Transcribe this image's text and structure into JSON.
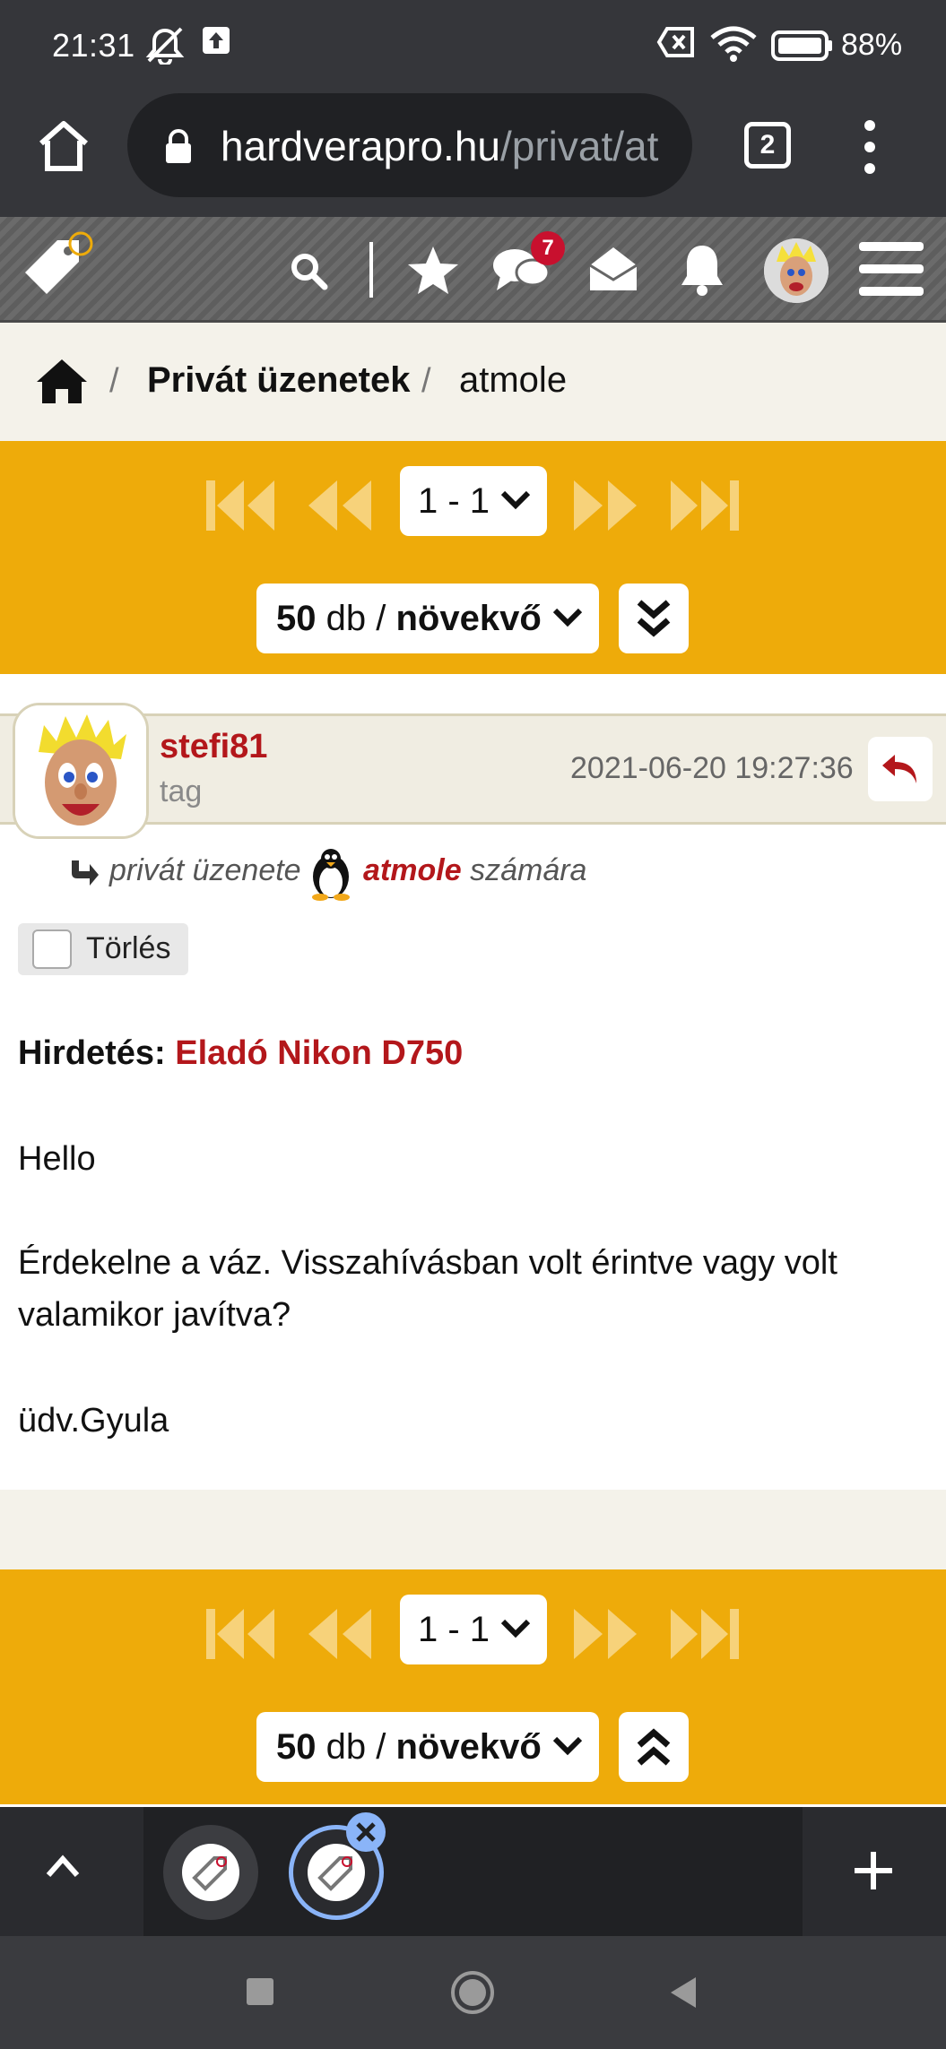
{
  "status_bar": {
    "time": "21:31",
    "battery": "88%",
    "icons": [
      "mute-icon",
      "upload-icon",
      "no-sim-icon",
      "wifi-icon",
      "battery-icon"
    ]
  },
  "browser": {
    "url_domain": "hardverapro.hu",
    "url_path": "/privat/at",
    "tab_count": "2"
  },
  "site_header": {
    "notification_count": "7",
    "icons": [
      "logo-tag-icon",
      "search-icon",
      "star-icon",
      "chat-icon",
      "mail-icon",
      "bell-icon",
      "avatar",
      "menu-icon"
    ]
  },
  "breadcrumb": {
    "items": [
      "Privát üzenetek",
      "atmole"
    ],
    "separator": "/"
  },
  "pager": {
    "page_range": "1 - 1",
    "count": "50",
    "count_unit": "db /",
    "order": "növekvő"
  },
  "message": {
    "username": "stefi81",
    "rank": "tag",
    "date": "2021-06-20 19:27:36",
    "recipient_prefix": "privát üzenete",
    "recipient_name": "atmole",
    "recipient_suffix": "számára",
    "delete_label": "Törlés",
    "ad_label": "Hirdetés:",
    "ad_title": "Eladó Nikon D750",
    "lines": [
      "Hello",
      "Érdekelne a váz. Visszahívásban volt érintve vagy volt valamikor javítva?",
      "üdv.Gyula"
    ]
  },
  "colors": {
    "accent": "#eeab0a",
    "link_red": "#b3171b",
    "chrome_dark": "#35363a"
  }
}
